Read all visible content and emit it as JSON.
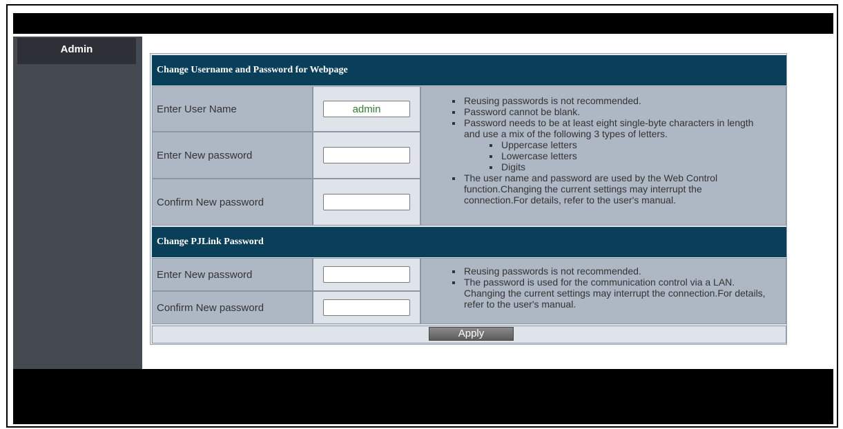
{
  "sidebar": {
    "items": [
      {
        "label": "Admin"
      }
    ]
  },
  "webpage_section": {
    "title": "Change Username and Password for Webpage",
    "rows": [
      {
        "label": "Enter User Name",
        "value": "admin"
      },
      {
        "label": "Enter New password",
        "value": ""
      },
      {
        "label": "Confirm New password",
        "value": ""
      }
    ],
    "notes": [
      "Reusing passwords is not recommended.",
      "Password cannot be blank.",
      "Password needs to be at least eight single-byte characters in length and use a mix of the following 3 types of letters.",
      "The user name and password are used by the Web Control function.Changing the current settings may interrupt the connection.For details, refer to the user's manual."
    ],
    "letter_types": [
      "Uppercase letters",
      "Lowercase letters",
      "Digits"
    ]
  },
  "pjlink_section": {
    "title": "Change PJLink Password",
    "rows": [
      {
        "label": "Enter New password",
        "value": ""
      },
      {
        "label": "Confirm New password",
        "value": ""
      }
    ],
    "notes": [
      "Reusing passwords is not recommended.",
      "The password is used for the communication control via a LAN. Changing the current settings may interrupt the connection.For details, refer to the user's manual."
    ]
  },
  "apply_label": "Apply",
  "colors": {
    "header": "#0a3f5a",
    "sidebar": "#454a51",
    "username_text": "#2e7d32"
  }
}
